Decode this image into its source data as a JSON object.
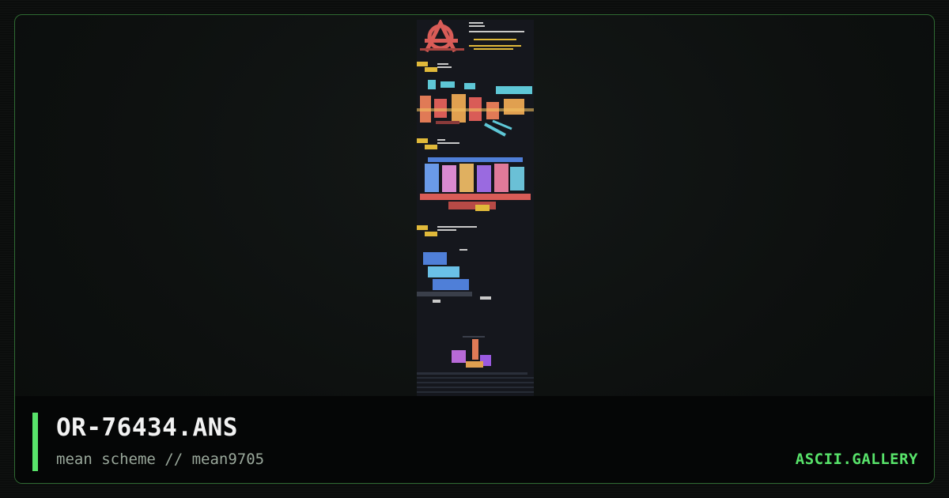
{
  "card": {
    "title": "OR-76434.ANS",
    "subtitle": "mean scheme // mean9705",
    "brand": "ASCII.GALLERY"
  },
  "colors": {
    "accent": "#58e36a",
    "frame_border": "#2f6a32",
    "title": "#f2f2f2",
    "subtitle": "#9aa89b",
    "art_background": "#15171d"
  }
}
